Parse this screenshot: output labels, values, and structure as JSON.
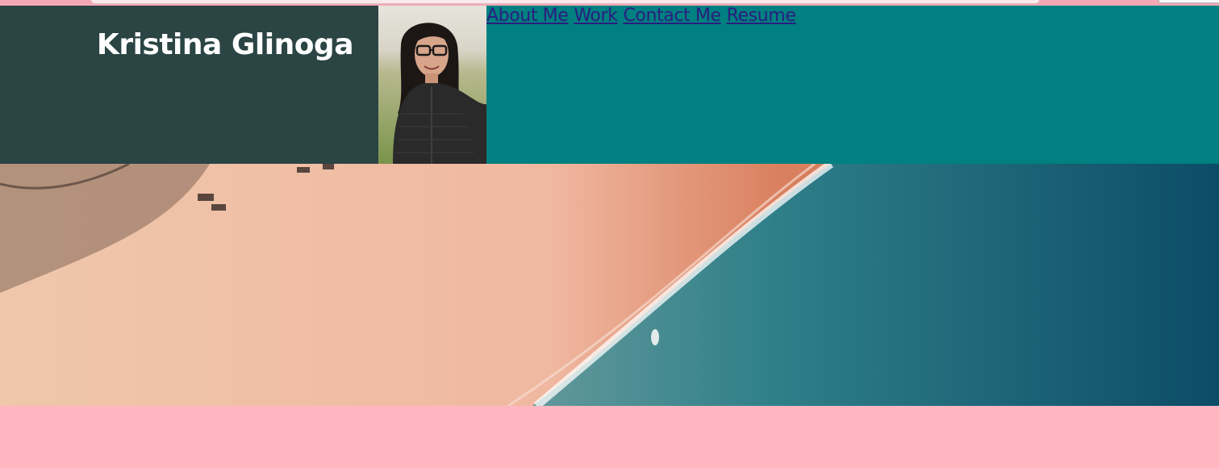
{
  "site": {
    "owner_name": "Kristina Glinoga"
  },
  "nav": {
    "links": [
      {
        "label": "About Me"
      },
      {
        "label": "Work"
      },
      {
        "label": "Contact Me"
      },
      {
        "label": "Resume"
      }
    ]
  },
  "colors": {
    "page_background": "#ffb6c1",
    "header_background": "#008080",
    "brand_background": "#2b4444",
    "name_text": "#ffffff",
    "nav_link": "#2b1d7f"
  },
  "media": {
    "avatar": "portrait-photo",
    "hero": "aerial-beach-photo"
  }
}
